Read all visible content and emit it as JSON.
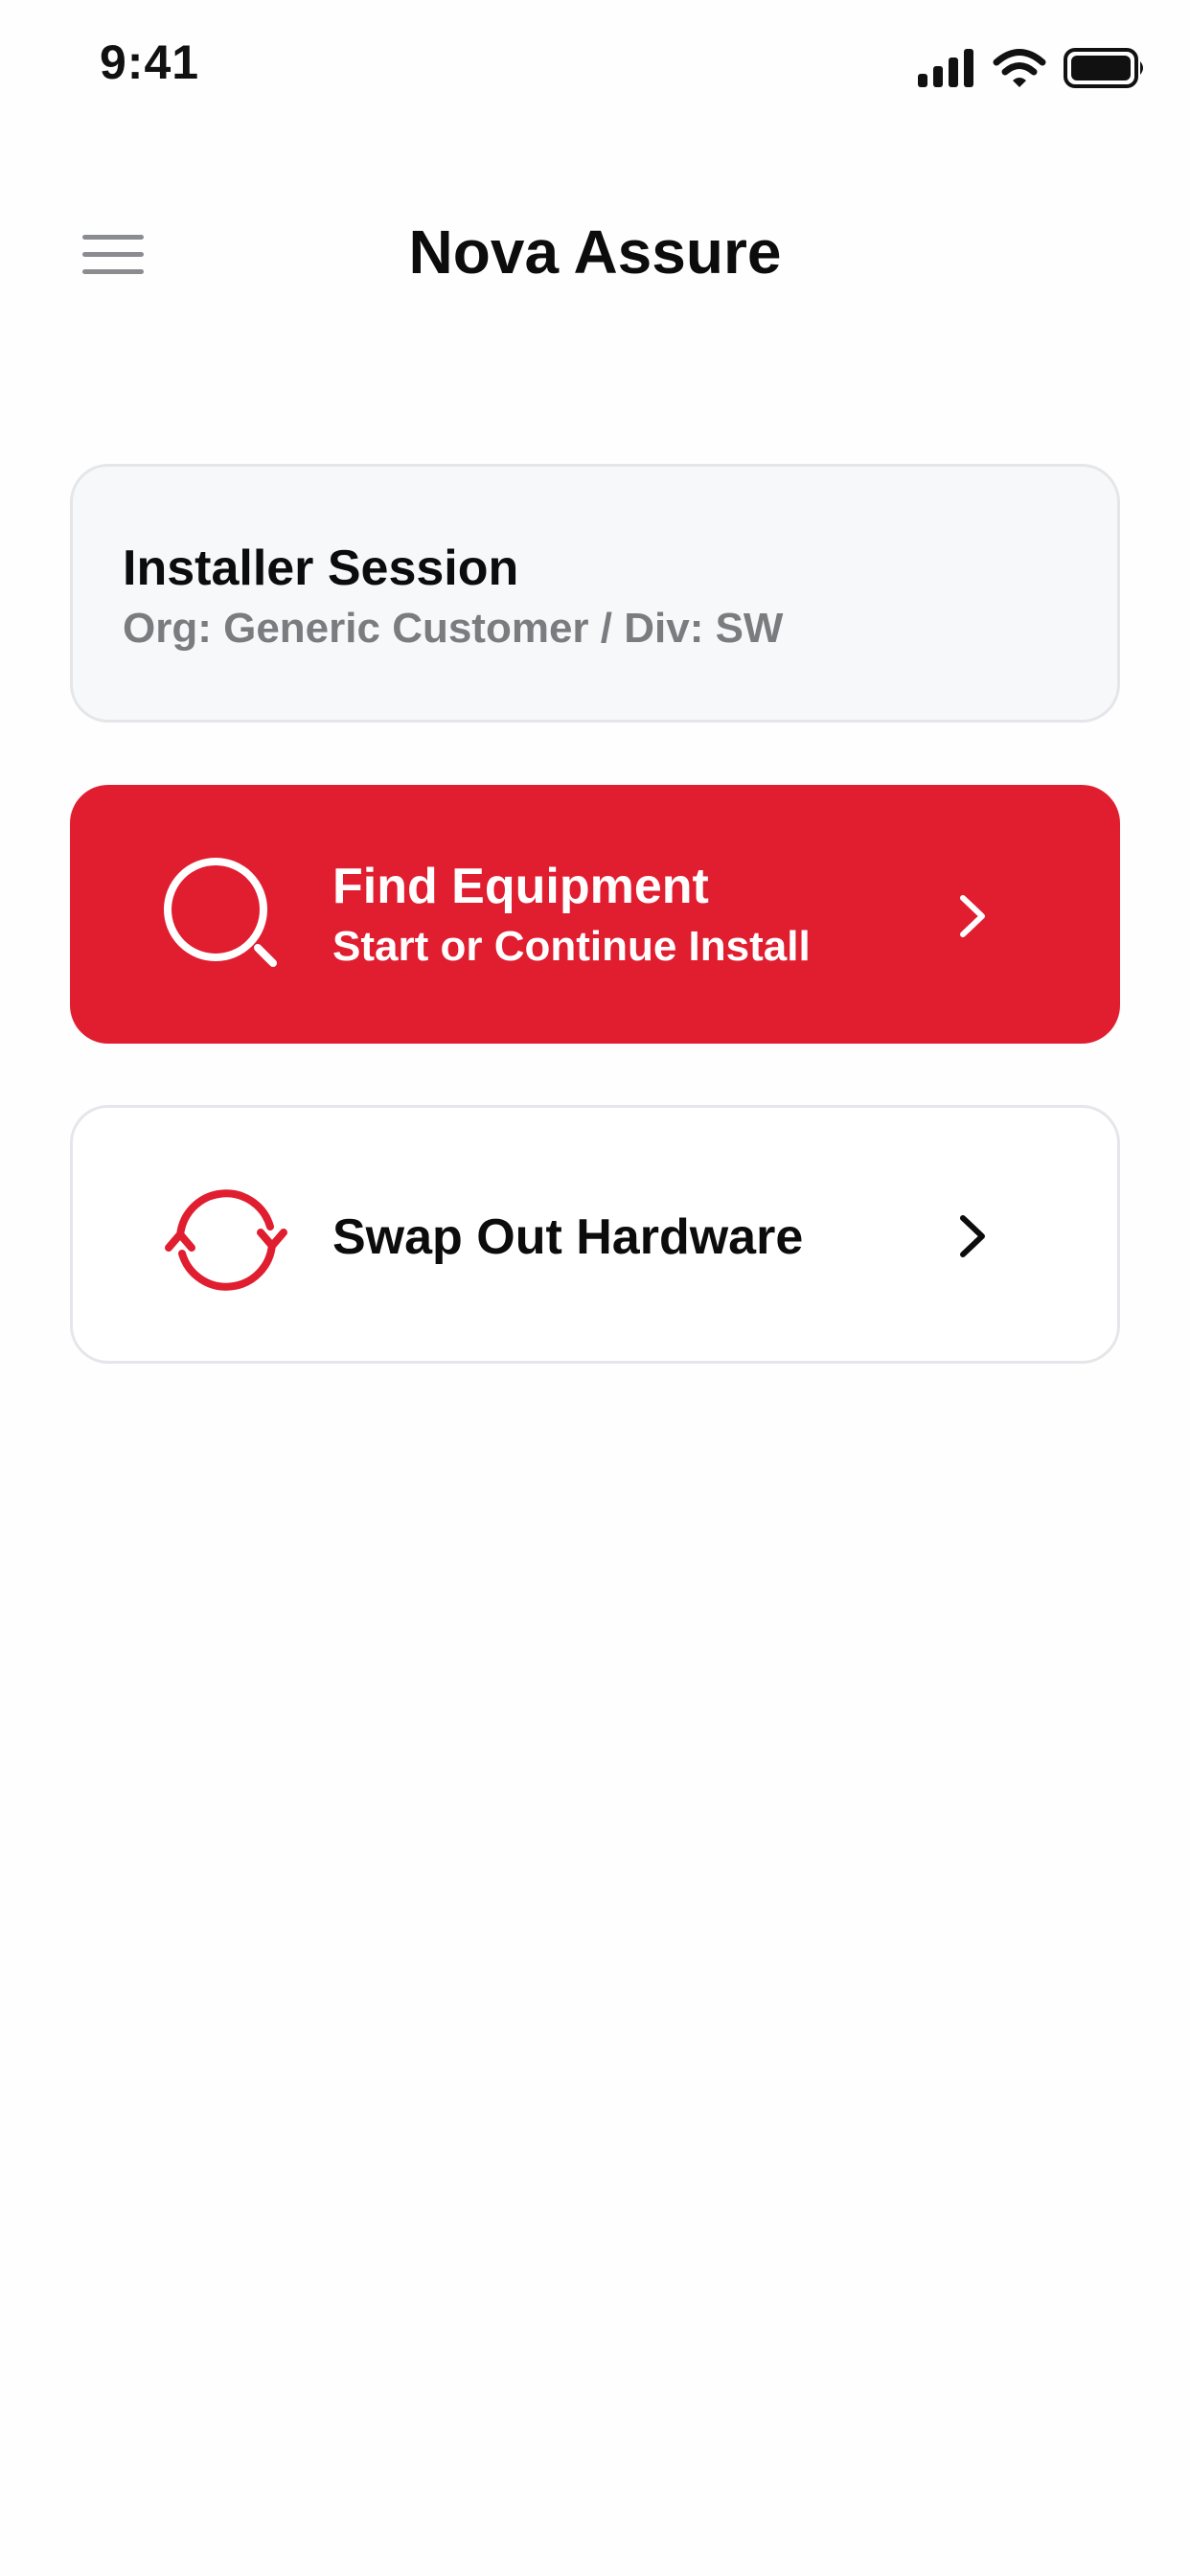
{
  "status_bar": {
    "time": "9:41",
    "icons": [
      "cellular-signal-icon",
      "wifi-icon",
      "battery-icon"
    ]
  },
  "header": {
    "title": "Nova Assure",
    "menu_icon": "hamburger-menu-icon"
  },
  "session_card": {
    "title": "Installer Session",
    "subtitle": "Org: Generic Customer / Div: SW"
  },
  "actions": [
    {
      "title": "Find Equipment",
      "subtitle": "Start or Continue Install",
      "icon": "search-icon",
      "trailing_icon": "chevron-right-icon"
    },
    {
      "title": "Swap Out Hardware",
      "icon": "swap-refresh-icon",
      "trailing_icon": "chevron-right-icon"
    }
  ],
  "colors": {
    "accent": "#e11d30",
    "card_background": "#f7f8fa",
    "card_border": "#e4e6e9",
    "secondary_text": "#7a7c80",
    "primary_text": "#0c0c0c"
  }
}
